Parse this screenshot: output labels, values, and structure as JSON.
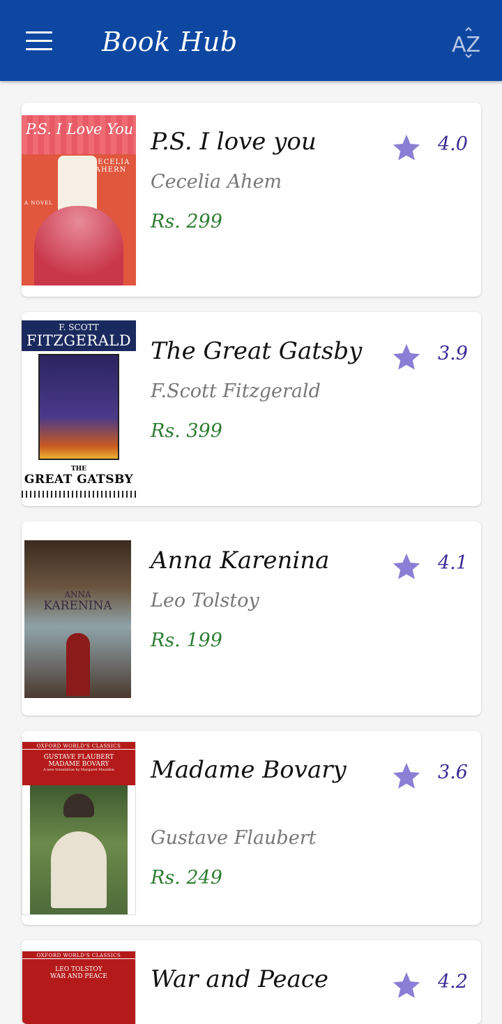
{
  "app": {
    "title": "Book Hub",
    "sort_label": "AZ"
  },
  "books": [
    {
      "title": "P.S. I love you",
      "author": "Cecelia Ahem",
      "price": "Rs. 299",
      "rating": "4.0",
      "cover": {
        "lines": [
          "P.S. I Love You",
          "CECELIA AHERN",
          "A NOVEL"
        ],
        "colors": {
          "bg": "#e0573d",
          "top": "#f06b73",
          "dress": "#c9384a"
        }
      }
    },
    {
      "title": "The Great Gatsby",
      "author": "F.Scott Fitzgerald",
      "price": "Rs. 399",
      "rating": "3.9",
      "cover": {
        "lines": [
          "F. SCOTT",
          "FITZGERALD",
          "THE",
          "GREAT GATSBY"
        ],
        "colors": {
          "bg": "#ffffff",
          "band": "#1a2a5e",
          "art": "#2b2460"
        }
      }
    },
    {
      "title": "Anna Karenina",
      "author": "Leo Tolstoy",
      "price": "Rs. 199",
      "rating": "4.1",
      "cover": {
        "lines": [
          "ANNA",
          "KARENINA"
        ],
        "colors": {
          "bg": "#5a4030",
          "mid": "#8fa3a8",
          "dress": "#8b1a1a"
        }
      }
    },
    {
      "title": "Madame Bovary",
      "author": "Gustave Flaubert",
      "price": "Rs. 249",
      "rating": "3.6",
      "cover": {
        "lines": [
          "OXFORD WORLD'S CLASSICS",
          "GUSTAVE FLAUBERT",
          "MADAME BOVARY",
          "A new translation by Margaret Mauldon"
        ],
        "colors": {
          "bg": "#b51a1a",
          "art": "#4e6b3a",
          "dress": "#e8e0d0"
        }
      }
    },
    {
      "title": "War and Peace",
      "author": "",
      "price": "",
      "rating": "4.2",
      "cover": {
        "lines": [
          "OXFORD WORLD'S CLASSICS",
          "LEO TOLSTOY",
          "WAR AND PEACE"
        ],
        "colors": {
          "bg": "#b51a1a"
        }
      }
    }
  ],
  "colors": {
    "appbar": "#0d47a1",
    "star": "#8a7fd4",
    "rating_text": "#3a2a94",
    "price": "#2e7d32",
    "author": "#777777"
  },
  "icons": {
    "menu": "hamburger-icon",
    "sort": "sort-alpha-icon",
    "rating": "star-icon"
  }
}
